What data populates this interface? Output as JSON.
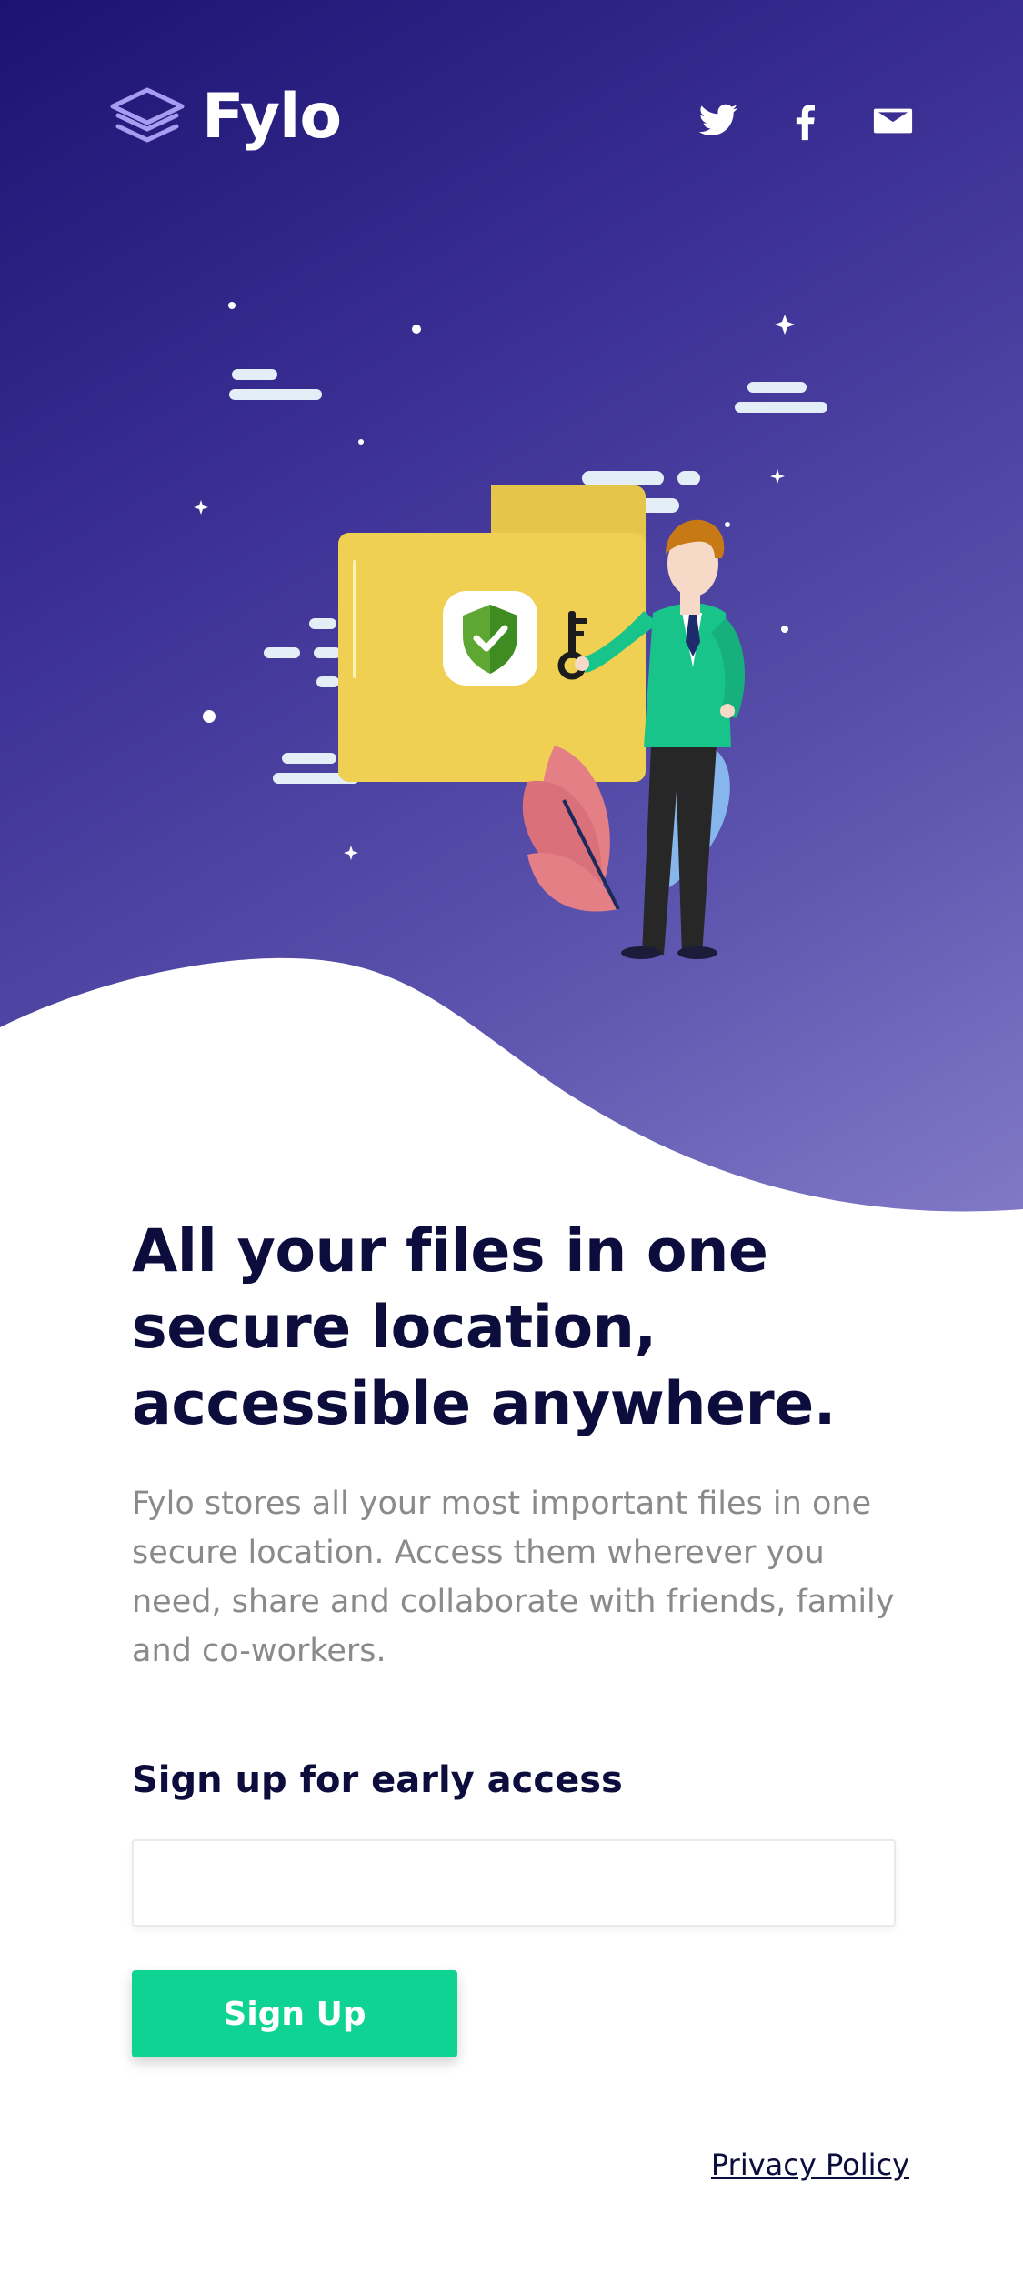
{
  "brand": {
    "name": "Fylo",
    "logo_icon": "stacked-layers-icon"
  },
  "social": [
    {
      "name": "Twitter",
      "icon": "twitter-icon"
    },
    {
      "name": "Facebook",
      "icon": "facebook-icon"
    },
    {
      "name": "Email",
      "icon": "envelope-icon"
    }
  ],
  "hero": {
    "illustration": "man-holding-key-beside-secure-folder",
    "gradient": [
      "#1b1371",
      "#8179c6"
    ]
  },
  "main": {
    "headline": "All your files in one secure location, accessible anywhere.",
    "description": "Fylo stores all your most important files in one secure location. Access them wherever you need, share and collaborate with friends, family and co-workers.",
    "signup_title": "Sign up for early access",
    "email_placeholder": "",
    "button_label": "Sign Up"
  },
  "footer": {
    "privacy_label": "Privacy Policy"
  },
  "colors": {
    "accent": "#0fd393",
    "heading": "#0c0c3d",
    "body_text": "#8a8a8a"
  }
}
